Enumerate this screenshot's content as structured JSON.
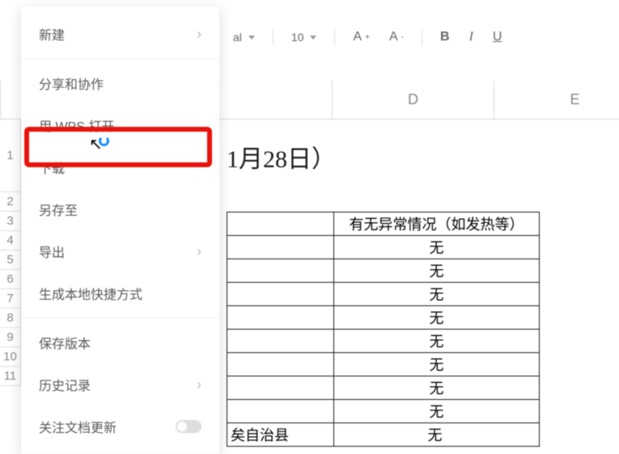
{
  "toolbar": {
    "font_name_partial": "al",
    "font_size": "10",
    "increase_font": "A",
    "decrease_font": "A",
    "bold": "B",
    "italic": "I",
    "underline": "U"
  },
  "menu": {
    "new": "新建",
    "share": "分享和协作",
    "open_wps": "用 WPS 打开",
    "download": "下载",
    "save_to": "另存至",
    "export": "导出",
    "create_shortcut": "生成本地快捷方式",
    "save_version": "保存版本",
    "history": "历史记录",
    "follow_updates": "关注文档更新"
  },
  "sheet": {
    "columns": {
      "d": "D",
      "e": "E"
    },
    "rows": [
      "1",
      "2",
      "3",
      "4",
      "5",
      "6",
      "7",
      "8",
      "9",
      "10",
      "11"
    ],
    "title_fragment": "1月28日）",
    "table": {
      "header_b": "有无异常情况（如发热等）",
      "values": [
        "无",
        "无",
        "无",
        "无",
        "无",
        "无",
        "无",
        "无",
        "无"
      ],
      "last_row_a": "矣自治县"
    }
  },
  "highlight_color": "#e8130b"
}
